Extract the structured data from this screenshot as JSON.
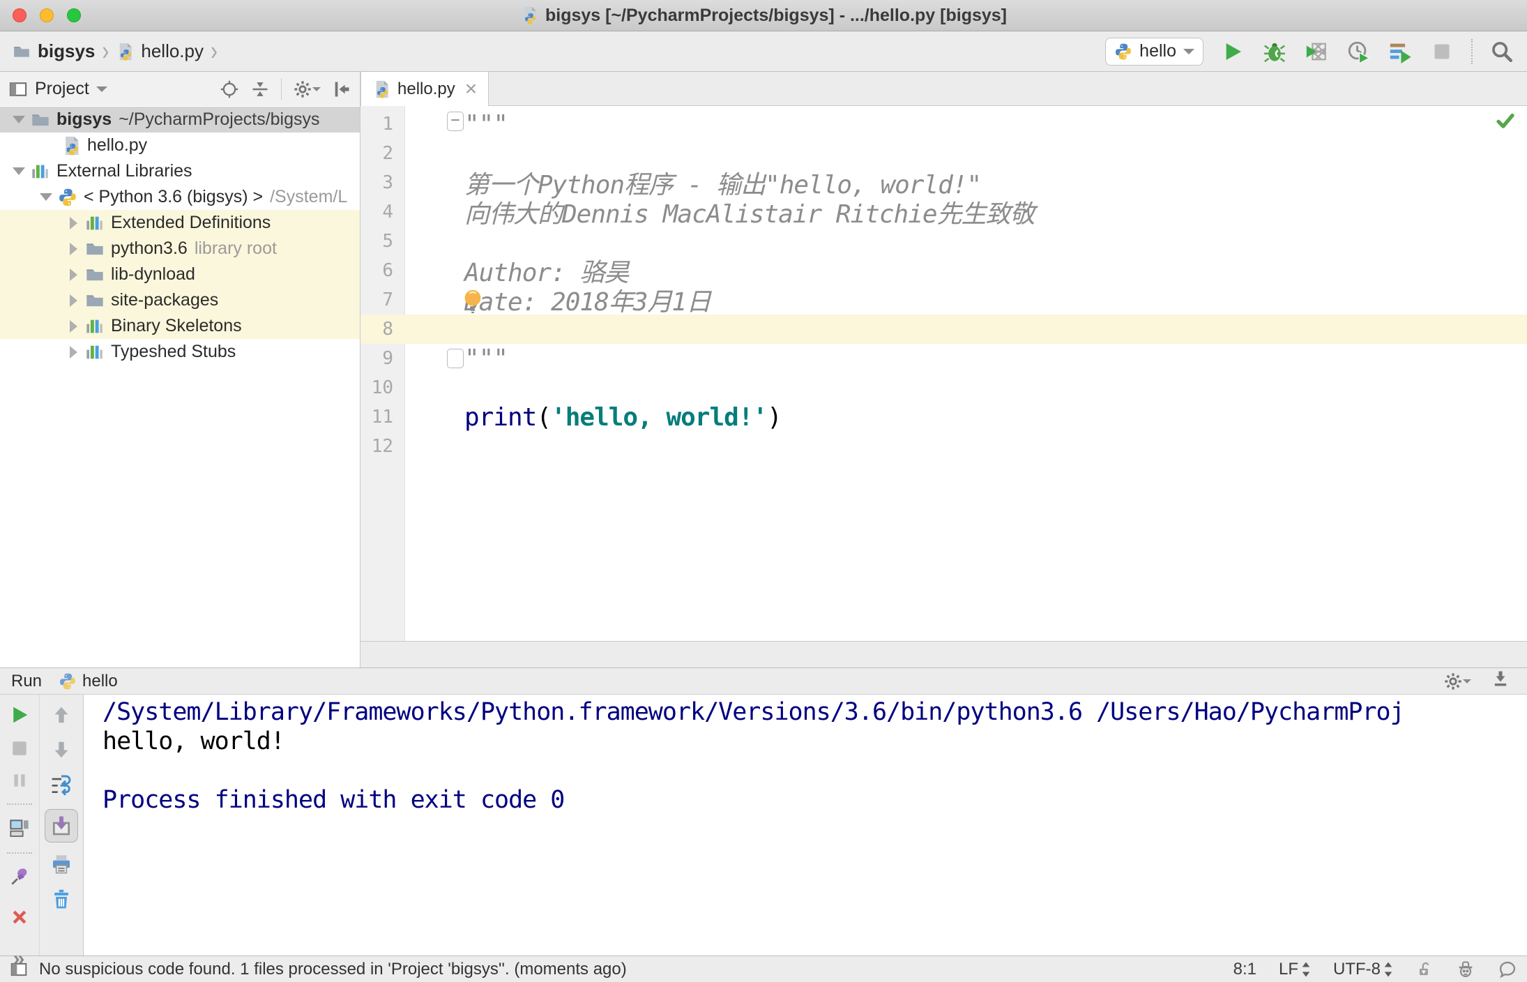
{
  "window": {
    "title": "bigsys [~/PycharmProjects/bigsys] - .../hello.py [bigsys]"
  },
  "toolbar": {
    "breadcrumbs": [
      {
        "label": "bigsys"
      },
      {
        "label": "hello.py"
      }
    ],
    "run_config": "hello"
  },
  "project_panel": {
    "title": "Project",
    "tree": [
      {
        "label": "bigsys",
        "path": "~/PycharmProjects/bigsys",
        "path_style": "dark",
        "icon": "folder",
        "arrow": "open",
        "indent": 0,
        "selected": true,
        "bold": true
      },
      {
        "label": "hello.py",
        "icon": "python-file",
        "indent": 2
      },
      {
        "label": "External Libraries",
        "icon": "library",
        "arrow": "open",
        "indent": 0
      },
      {
        "label": "< Python 3.6 (bigsys) >",
        "path": "/System/L",
        "icon": "python",
        "arrow": "open",
        "indent": 1
      },
      {
        "label": "Extended Definitions",
        "icon": "library",
        "arrow": "closed",
        "indent": 2,
        "highlight": true
      },
      {
        "label": "python3.6",
        "path": "library root",
        "icon": "folder",
        "arrow": "closed",
        "indent": 2,
        "highlight": true
      },
      {
        "label": "lib-dynload",
        "icon": "folder",
        "arrow": "closed",
        "indent": 2,
        "highlight": true
      },
      {
        "label": "site-packages",
        "icon": "folder",
        "arrow": "closed",
        "indent": 2,
        "highlight": true
      },
      {
        "label": "Binary Skeletons",
        "icon": "library",
        "arrow": "closed",
        "indent": 2,
        "highlight": true
      },
      {
        "label": "Typeshed Stubs",
        "icon": "library",
        "arrow": "closed",
        "indent": 2
      }
    ]
  },
  "editor": {
    "tab_label": "hello.py",
    "lines": [
      {
        "n": 1,
        "segments": [
          {
            "t": "\"\"\"",
            "c": "doc"
          }
        ]
      },
      {
        "n": 2,
        "segments": []
      },
      {
        "n": 3,
        "segments": [
          {
            "t": "第一个Python程序 - 输出\"hello, world!\"",
            "c": "doc"
          }
        ]
      },
      {
        "n": 4,
        "segments": [
          {
            "t": "向伟大的Dennis MacAlistair Ritchie先生致敬",
            "c": "doc"
          }
        ]
      },
      {
        "n": 5,
        "segments": []
      },
      {
        "n": 6,
        "segments": [
          {
            "t": "Author: 骆昊",
            "c": "doc"
          }
        ]
      },
      {
        "n": 7,
        "segments": [
          {
            "t": "Date: 2018年3月1日",
            "c": "doc"
          }
        ]
      },
      {
        "n": 8,
        "segments": [],
        "current": true
      },
      {
        "n": 9,
        "segments": [
          {
            "t": "\"\"\"",
            "c": "doc"
          }
        ]
      },
      {
        "n": 10,
        "segments": []
      },
      {
        "n": 11,
        "segments": [
          {
            "t": "print",
            "c": "kw"
          },
          {
            "t": "(",
            "c": "plain"
          },
          {
            "t": "'hello, world!'",
            "c": "str"
          },
          {
            "t": ")",
            "c": "plain"
          }
        ]
      },
      {
        "n": 12,
        "segments": []
      }
    ]
  },
  "run_panel": {
    "title": "Run",
    "tab": "hello",
    "console": [
      {
        "text": "/System/Library/Frameworks/Python.framework/Versions/3.6/bin/python3.6 /Users/Hao/PycharmProj",
        "color": "system"
      },
      {
        "text": "hello, world!",
        "color": "stdout"
      },
      {
        "text": "",
        "color": "stdout"
      },
      {
        "text": "Process finished with exit code 0",
        "color": "system"
      }
    ]
  },
  "status_bar": {
    "message": "No suspicious code found. 1 files processed in 'Project 'bigsys''. (moments ago)",
    "position": "8:1",
    "line_separator": "LF",
    "encoding": "UTF-8"
  },
  "colors": {
    "run_green": "#3fab4a",
    "keyword": "#000080",
    "string": "#067d7b",
    "comment_doc": "#8c8c8c",
    "console_system": "#000080",
    "selection_bg": "#d4d4d4",
    "tree_highlight_bg": "#fbf7dc",
    "current_line_bg": "#fcf6da"
  }
}
